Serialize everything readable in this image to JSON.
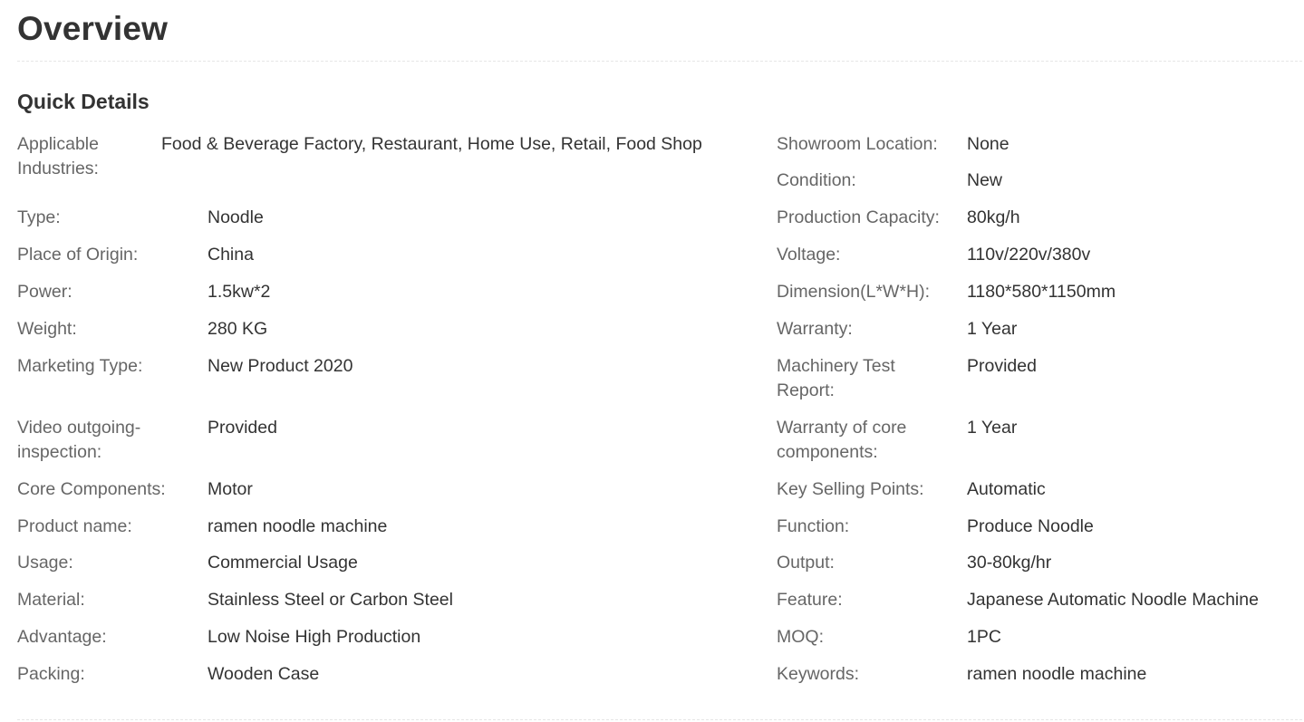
{
  "page_title": "Overview",
  "section_title": "Quick Details",
  "left_details": [
    {
      "label": "Applicable Industries:",
      "value": "Food & Beverage Factory, Restaurant, Home Use, Retail, Food Shop"
    },
    {
      "label": "Type:",
      "value": "Noodle"
    },
    {
      "label": "Place of Origin:",
      "value": "China"
    },
    {
      "label": "Power:",
      "value": "1.5kw*2"
    },
    {
      "label": "Weight:",
      "value": "280 KG"
    },
    {
      "label": "Marketing Type:",
      "value": "New Product 2020"
    },
    {
      "label": "Video outgoing-inspection:",
      "value": "Provided"
    },
    {
      "label": "Core Components:",
      "value": "Motor"
    },
    {
      "label": "Product name:",
      "value": "ramen noodle machine"
    },
    {
      "label": "Usage:",
      "value": "Commercial Usage"
    },
    {
      "label": "Material:",
      "value": "Stainless Steel or Carbon Steel"
    },
    {
      "label": "Advantage:",
      "value": "Low Noise High Production"
    },
    {
      "label": "Packing:",
      "value": "Wooden Case"
    }
  ],
  "right_details": [
    {
      "label": "Showroom Location:",
      "value": "None"
    },
    {
      "label": "Condition:",
      "value": "New"
    },
    {
      "label": "Production Capacity:",
      "value": "80kg/h"
    },
    {
      "label": "Voltage:",
      "value": "110v/220v/380v"
    },
    {
      "label": "Dimension(L*W*H):",
      "value": "1180*580*1150mm"
    },
    {
      "label": "Warranty:",
      "value": "1 Year"
    },
    {
      "label": "Machinery Test Report:",
      "value": "Provided"
    },
    {
      "label": "Warranty of core components:",
      "value": "1 Year"
    },
    {
      "label": "Key Selling Points:",
      "value": "Automatic"
    },
    {
      "label": "Function:",
      "value": "Produce Noodle"
    },
    {
      "label": "Output:",
      "value": "30-80kg/hr"
    },
    {
      "label": "Feature:",
      "value": "Japanese Automatic Noodle Machine"
    },
    {
      "label": "MOQ:",
      "value": "1PC"
    },
    {
      "label": "Keywords:",
      "value": "ramen noodle machine"
    }
  ]
}
